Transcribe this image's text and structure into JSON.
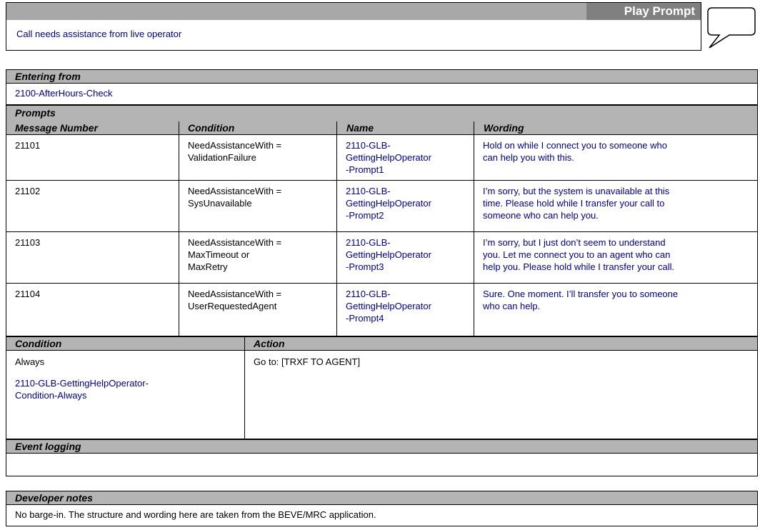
{
  "header": {
    "title": "Play Prompt",
    "description": "Call needs assistance from live operator"
  },
  "entering_from": {
    "label": "Entering from",
    "value": "2100-AfterHours-Check"
  },
  "prompts": {
    "label": "Prompts",
    "columns": [
      "Message Number",
      "Condition",
      "Name",
      "Wording"
    ],
    "rows": [
      {
        "number": "21101",
        "condition": [
          "NeedAssistanceWith =",
          "ValidationFailure"
        ],
        "name": [
          "2110-GLB-",
          "GettingHelpOperator",
          "-Prompt1"
        ],
        "wording": [
          "Hold on while I connect you to someone who",
          "can help you with this."
        ]
      },
      {
        "number": "21102",
        "condition": [
          "NeedAssistanceWith =",
          "SysUnavailable"
        ],
        "name": [
          "2110-GLB-",
          "GettingHelpOperator",
          "-Prompt2"
        ],
        "wording": [
          "I’m sorry, but the system is unavailable at this",
          "time. Please hold while I transfer your call to",
          "someone who can help you."
        ]
      },
      {
        "number": "21103",
        "condition": [
          "NeedAssistanceWith =",
          "MaxTimeout or",
          "MaxRetry"
        ],
        "name": [
          "2110-GLB-",
          "GettingHelpOperator",
          "-Prompt3"
        ],
        "wording": [
          "I’m sorry, but I just don’t seem to understand",
          "you. Let me connect you to an agent who can",
          "help you. Please hold while I transfer your call."
        ]
      },
      {
        "number": "21104",
        "condition": [
          "NeedAssistanceWith =",
          "UserRequestedAgent"
        ],
        "name": [
          "2110-GLB-",
          "GettingHelpOperator",
          "-Prompt4"
        ],
        "wording": [
          "Sure. One moment. I’ll transfer you to someone",
          "who can help."
        ]
      }
    ]
  },
  "condition_action": {
    "condition_label": "Condition",
    "action_label": "Action",
    "condition_value": "Always",
    "condition_name": [
      "2110-GLB-GettingHelpOperator-",
      "Condition-Always"
    ],
    "action_value": "Go to: [TRXF TO AGENT]"
  },
  "event_logging": {
    "label": "Event logging",
    "value": ""
  },
  "developer_notes": {
    "label": "Developer notes",
    "value": "No barge-in. The structure and wording here are taken from the BEVE/MRC application."
  }
}
